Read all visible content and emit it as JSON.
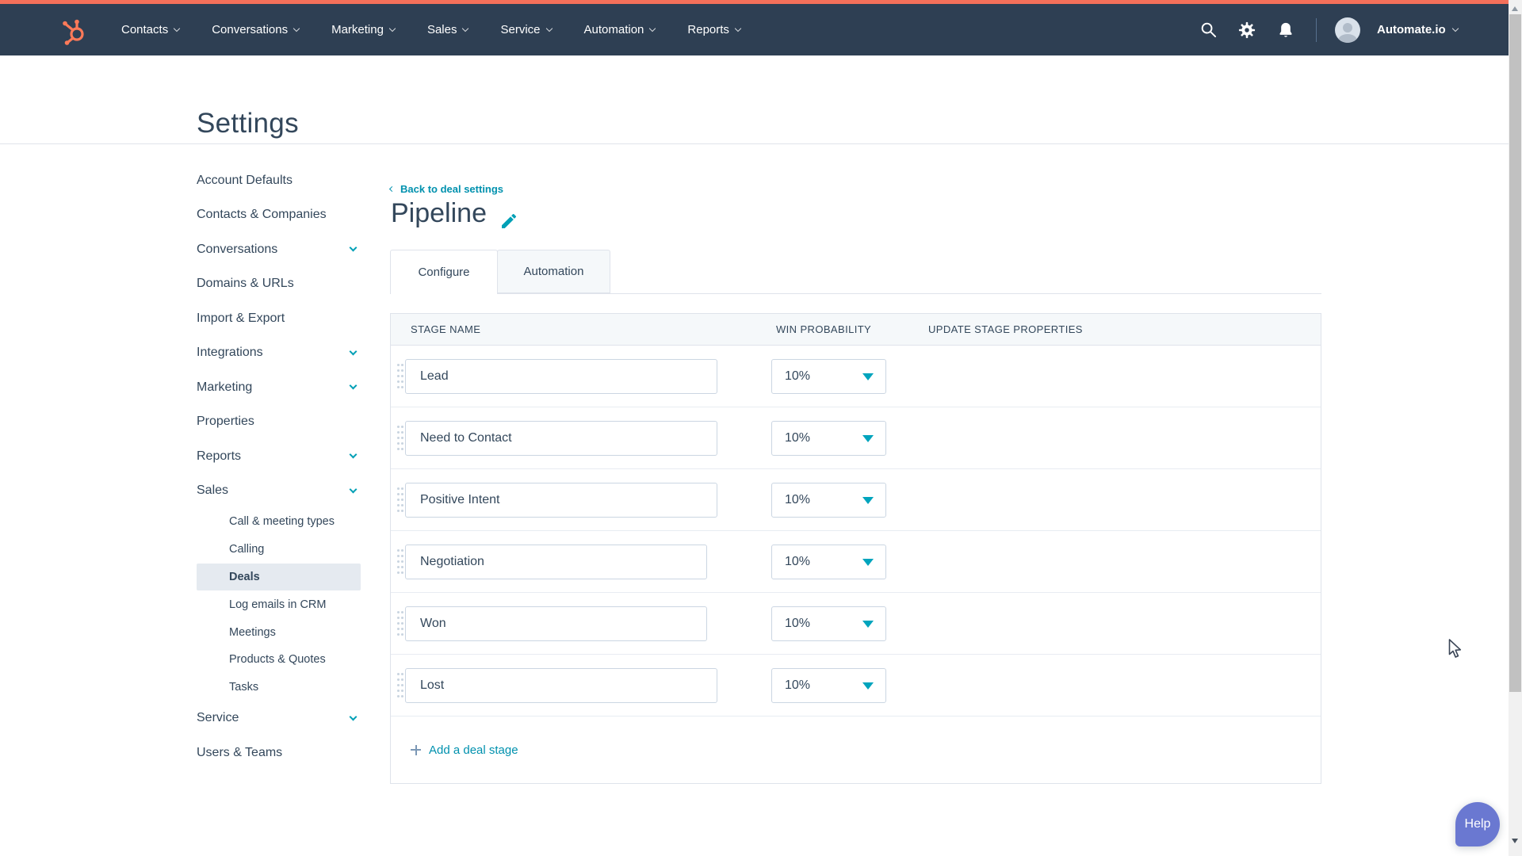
{
  "topnav": {
    "items": [
      {
        "label": "Contacts"
      },
      {
        "label": "Conversations"
      },
      {
        "label": "Marketing"
      },
      {
        "label": "Sales"
      },
      {
        "label": "Service"
      },
      {
        "label": "Automation"
      },
      {
        "label": "Reports"
      }
    ],
    "icons": [
      "search-icon",
      "gear-icon",
      "bell-icon"
    ],
    "account": {
      "name": "Automate.io"
    }
  },
  "page": {
    "title": "Settings"
  },
  "sidebar": {
    "items": [
      {
        "label": "Account Defaults",
        "chevron": false
      },
      {
        "label": "Contacts & Companies",
        "chevron": false
      },
      {
        "label": "Conversations",
        "chevron": true
      },
      {
        "label": "Domains & URLs",
        "chevron": false
      },
      {
        "label": "Import & Export",
        "chevron": false
      },
      {
        "label": "Integrations",
        "chevron": true
      },
      {
        "label": "Marketing",
        "chevron": true
      },
      {
        "label": "Properties",
        "chevron": false
      },
      {
        "label": "Reports",
        "chevron": true
      },
      {
        "label": "Sales",
        "chevron": true,
        "expanded": true
      },
      {
        "label": "Service",
        "chevron": true
      },
      {
        "label": "Users & Teams",
        "chevron": false
      }
    ],
    "sales_subitems": [
      {
        "label": "Call & meeting types",
        "selected": false
      },
      {
        "label": "Calling",
        "selected": false
      },
      {
        "label": "Deals",
        "selected": true
      },
      {
        "label": "Log emails in CRM",
        "selected": false
      },
      {
        "label": "Meetings",
        "selected": false
      },
      {
        "label": "Products & Quotes",
        "selected": false
      },
      {
        "label": "Tasks",
        "selected": false
      }
    ]
  },
  "main": {
    "back_link": "Back to deal settings",
    "title": "Pipeline",
    "tabs": [
      {
        "label": "Configure",
        "active": true
      },
      {
        "label": "Automation",
        "active": false
      }
    ],
    "table": {
      "columns": [
        "STAGE NAME",
        "WIN PROBABILITY",
        "UPDATE STAGE PROPERTIES"
      ],
      "rows": [
        {
          "stage": "Lead",
          "win_probability": "10%"
        },
        {
          "stage": "Need to Contact",
          "win_probability": "10%"
        },
        {
          "stage": "Positive Intent",
          "win_probability": "10%"
        },
        {
          "stage": "Negotiation",
          "win_probability": "10%"
        },
        {
          "stage": "Won",
          "win_probability": "10%"
        },
        {
          "stage": "Lost",
          "win_probability": "10%"
        }
      ],
      "add_link": "Add a deal stage"
    }
  },
  "help": {
    "label": "Help"
  },
  "colors": {
    "topbar_bg": "#2e3f53",
    "accent_orange": "#ff7a59",
    "link_teal": "#0091ae",
    "icon_teal": "#00a4bd",
    "text": "#33475b",
    "border": "#dfe3eb",
    "input_border": "#cbd6e2",
    "table_header_bg": "#f5f8fa",
    "selected_item_bg": "#e5eaf0",
    "help_bg": "#6a78d1"
  }
}
